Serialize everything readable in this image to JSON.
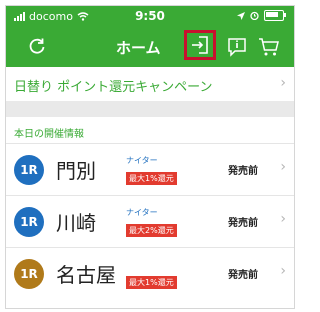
{
  "status_bar": {
    "carrier": "docomo",
    "time": "9:50"
  },
  "nav": {
    "title": "ホーム",
    "icons": [
      "refresh-icon",
      "login-icon",
      "info-icon",
      "cart-icon"
    ],
    "highlight_color": "#c8102e",
    "bar_color": "#3aaa35"
  },
  "banner": {
    "text": "日替り ポイント還元キャンペーン"
  },
  "section": {
    "title": "本日の開催情報"
  },
  "races": [
    {
      "badge": "1R",
      "badge_color": "#1f6fbf",
      "venue": "門別",
      "night": "ナイター",
      "promo": "最大1%還元",
      "status": "発売前"
    },
    {
      "badge": "1R",
      "badge_color": "#1f6fbf",
      "venue": "川崎",
      "night": "ナイター",
      "promo": "最大2%還元",
      "status": "発売前"
    },
    {
      "badge": "1R",
      "badge_color": "#b07a1a",
      "venue": "名古屋",
      "night": "",
      "promo": "最大1%還元",
      "status": "発売前"
    }
  ]
}
